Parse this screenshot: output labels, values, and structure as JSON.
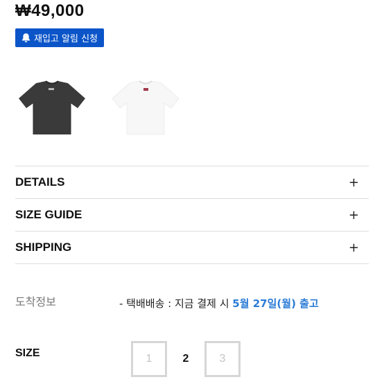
{
  "product": {
    "price": "₩49,000",
    "restock_button_label": "재입고 알림 신청",
    "restock_icon": "bell-icon",
    "colors": [
      {
        "name": "black",
        "hex": "#3a3a3a"
      },
      {
        "name": "white",
        "hex": "#f7f7f7"
      }
    ]
  },
  "accordion": [
    {
      "label": "DETAILS",
      "toggle": "+"
    },
    {
      "label": "SIZE GUIDE",
      "toggle": "+"
    },
    {
      "label": "SHIPPING",
      "toggle": "+"
    }
  ],
  "arrival": {
    "label": "도착정보",
    "prefix": "- 택배배송 : 지금 결제 시 ",
    "date": "5월 27일(월)",
    "suffix": " 출고"
  },
  "size": {
    "label": "SIZE",
    "options": [
      {
        "value": "1",
        "state": "disabled"
      },
      {
        "value": "2",
        "state": "available"
      },
      {
        "value": "3",
        "state": "disabled"
      }
    ]
  },
  "colors": {
    "accent": "#0b55c9",
    "date_highlight": "#2a7bd6"
  }
}
